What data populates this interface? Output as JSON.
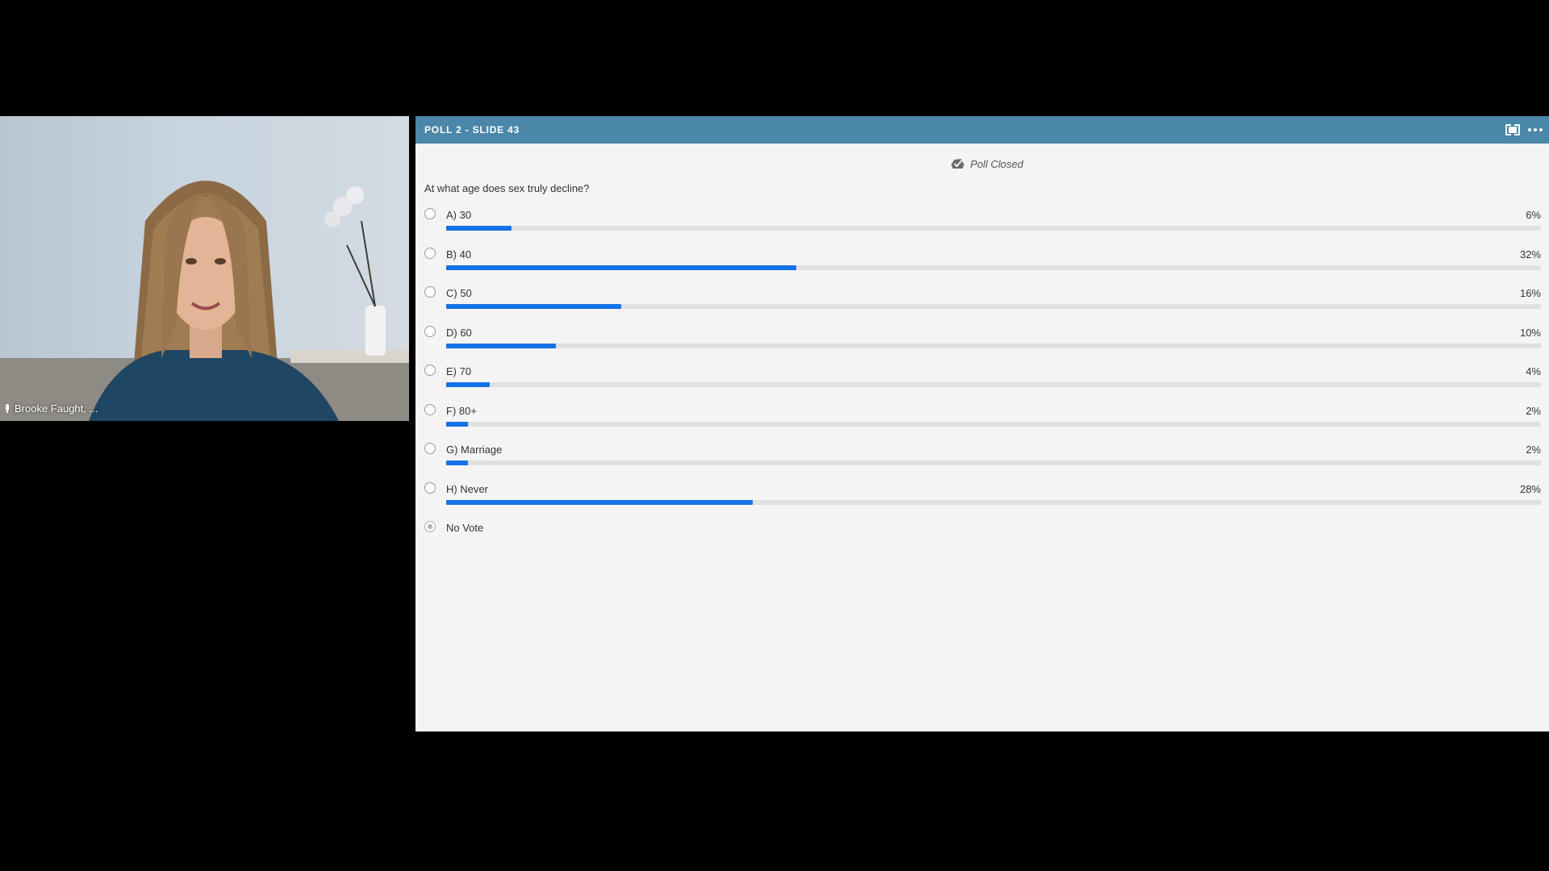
{
  "video": {
    "participant_name": "Brooke Faught, ..."
  },
  "poll": {
    "title": "POLL 2 - SLIDE 43",
    "status": "Poll Closed",
    "question": "At what age does sex truly decline?",
    "options": [
      {
        "label": "A) 30",
        "percent_text": "6%",
        "percent": 6
      },
      {
        "label": "B) 40",
        "percent_text": "32%",
        "percent": 32
      },
      {
        "label": "C) 50",
        "percent_text": "16%",
        "percent": 16
      },
      {
        "label": "D) 60",
        "percent_text": "10%",
        "percent": 10
      },
      {
        "label": "E) 70",
        "percent_text": "4%",
        "percent": 4
      },
      {
        "label": "F) 80+",
        "percent_text": "2%",
        "percent": 2
      },
      {
        "label": "G) Marriage",
        "percent_text": "2%",
        "percent": 2
      },
      {
        "label": "H) Never",
        "percent_text": "28%",
        "percent": 28
      }
    ],
    "no_vote_label": "No Vote"
  },
  "colors": {
    "header": "#4a87a8",
    "bar_fill": "#1473e6",
    "bar_track": "#e0e0e0",
    "panel_bg": "#f4f4f4"
  }
}
